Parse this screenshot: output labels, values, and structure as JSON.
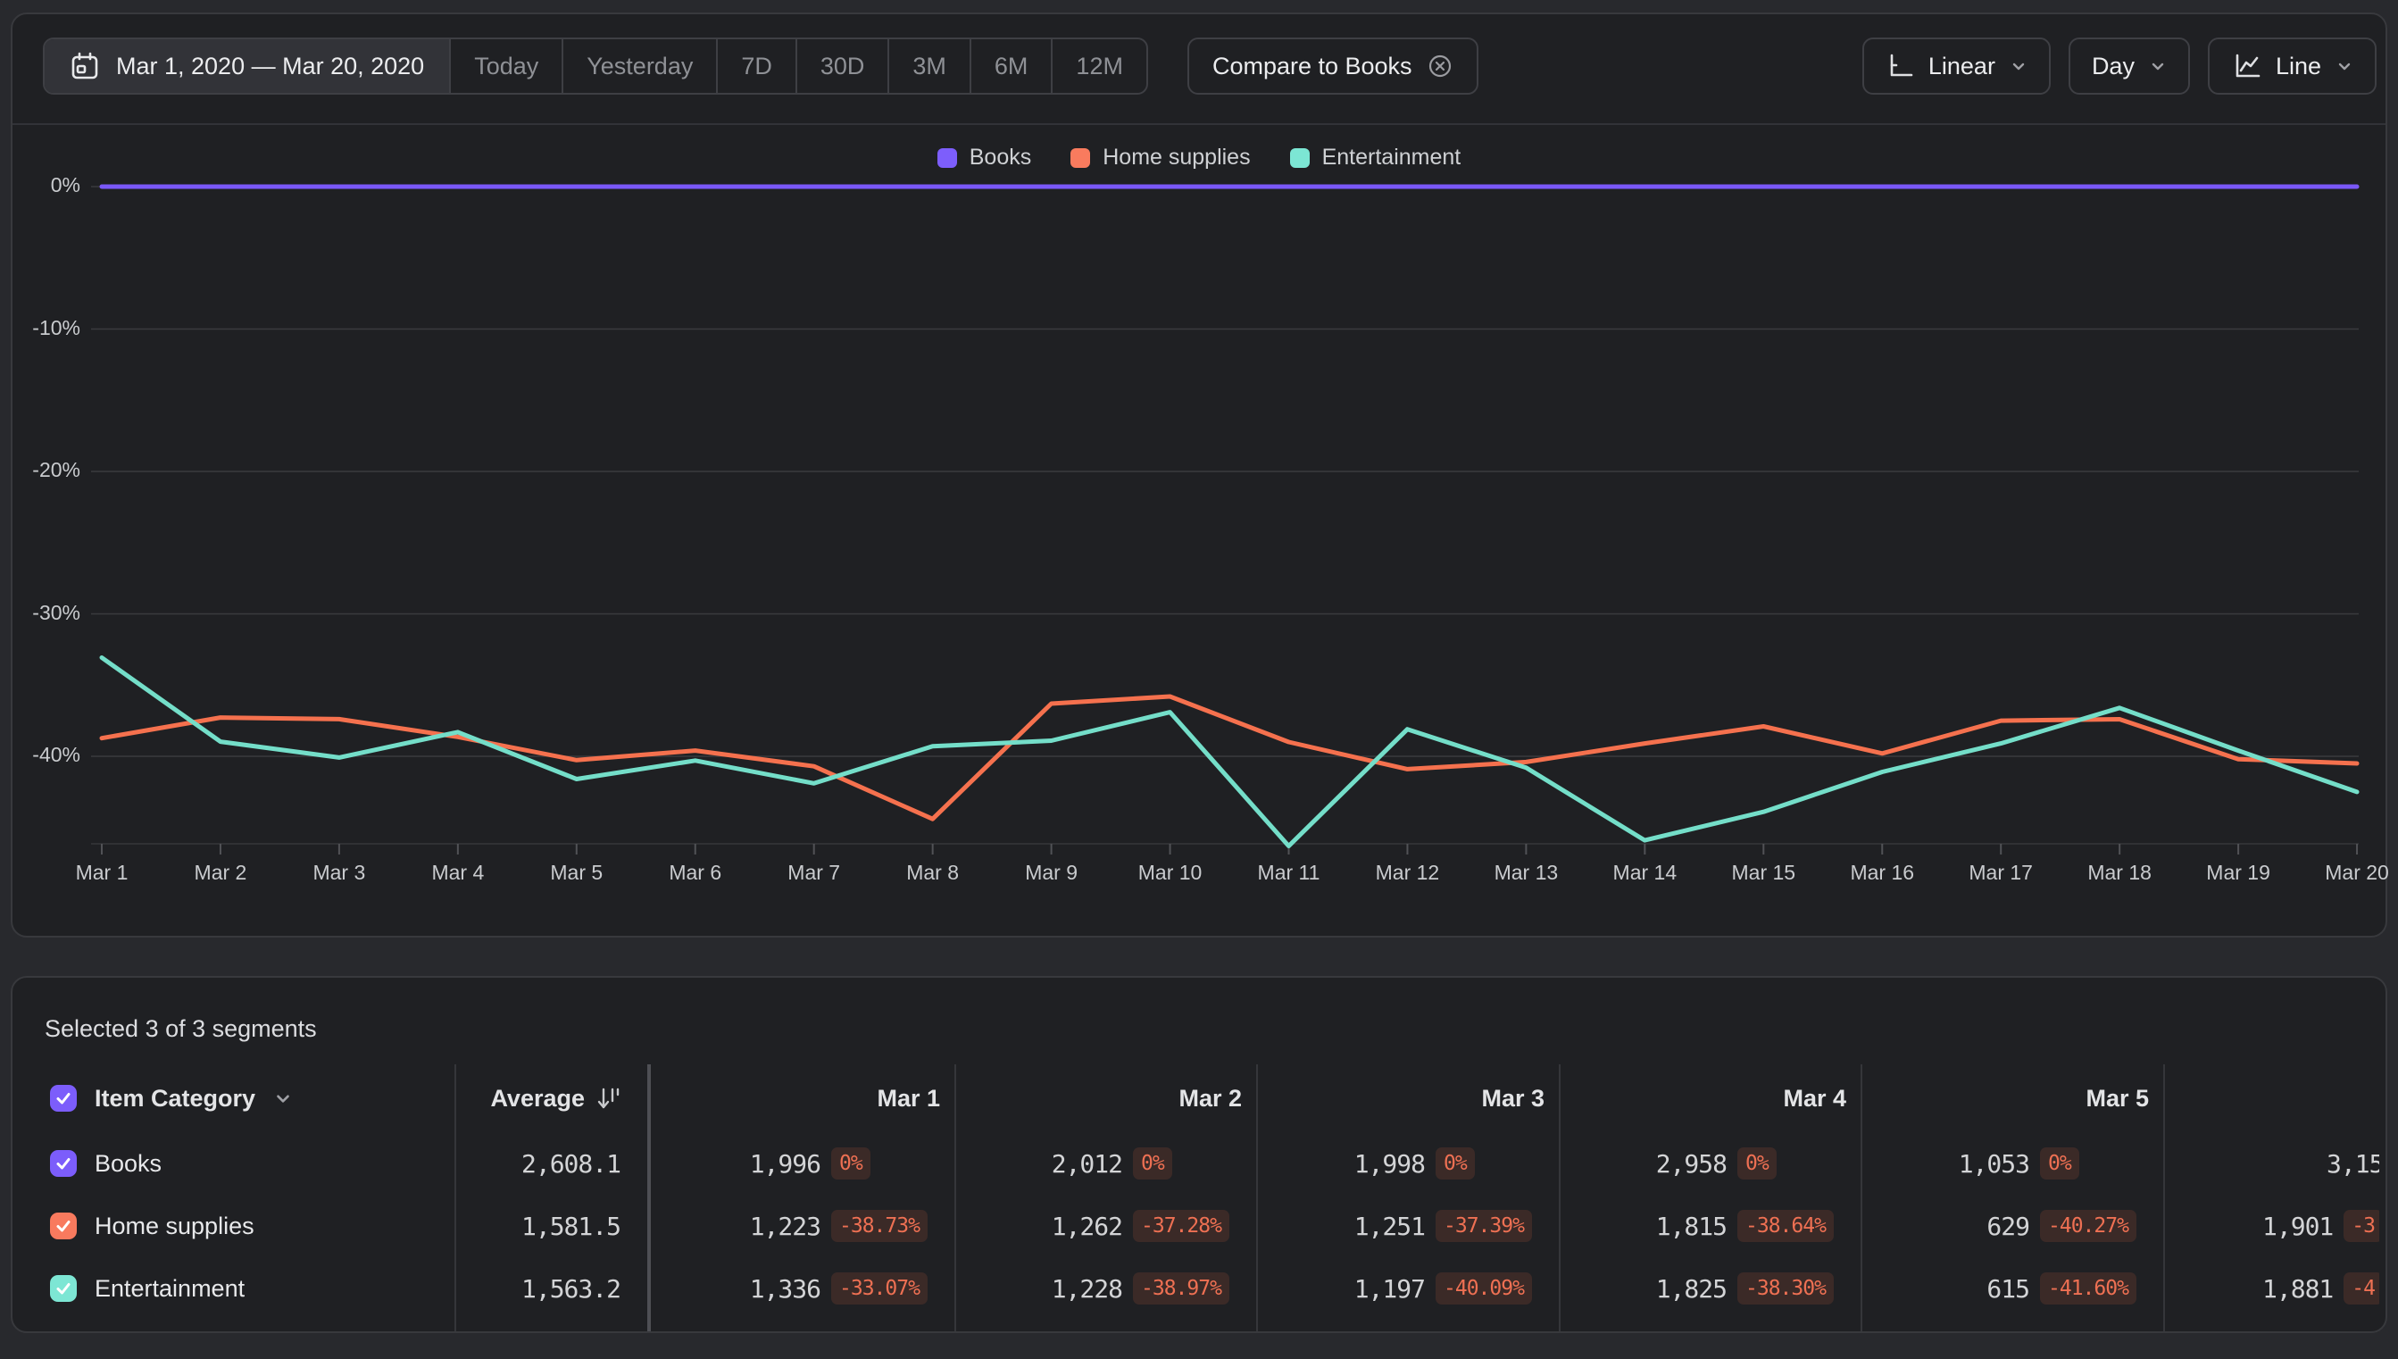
{
  "toolbar": {
    "date_range": "Mar 1, 2020 — Mar 20, 2020",
    "presets": [
      "Today",
      "Yesterday",
      "7D",
      "30D",
      "3M",
      "6M",
      "12M"
    ],
    "compare_chip": "Compare to Books",
    "scale_button": "Linear",
    "interval_button": "Day",
    "chart_type_button": "Line"
  },
  "colors": {
    "books": "#7c5dfb",
    "home_supplies": "#f87a5e",
    "entertainment": "#7de6d4",
    "badge_bg": "#3b2a27",
    "badge_text": "#ee7053",
    "gridline": "#3a3b3e"
  },
  "legend": [
    {
      "label": "Books",
      "color": "#7d5efc"
    },
    {
      "label": "Home supplies",
      "color": "#f97b5e"
    },
    {
      "label": "Entertainment",
      "color": "#7ce6d4"
    }
  ],
  "chart_data": {
    "type": "line",
    "title": "",
    "xlabel": "",
    "ylabel": "%",
    "x": [
      "Mar 1",
      "Mar 2",
      "Mar 3",
      "Mar 4",
      "Mar 5",
      "Mar 6",
      "Mar 7",
      "Mar 8",
      "Mar 9",
      "Mar 10",
      "Mar 11",
      "Mar 12",
      "Mar 13",
      "Mar 14",
      "Mar 15",
      "Mar 16",
      "Mar 17",
      "Mar 18",
      "Mar 19",
      "Mar 20"
    ],
    "y_ticks": [
      0,
      -10,
      -20,
      -30,
      -40
    ],
    "ylim": [
      -46.2,
      0
    ],
    "grid": true,
    "legend_position": "top-center",
    "series": [
      {
        "name": "Books",
        "color": "#7a58f8",
        "values": [
          0,
          0,
          0,
          0,
          0,
          0,
          0,
          0,
          0,
          0,
          0,
          0,
          0,
          0,
          0,
          0,
          0,
          0,
          0,
          0
        ]
      },
      {
        "name": "Home supplies",
        "color": "#f5714e",
        "values": [
          -38.73,
          -37.28,
          -37.39,
          -38.64,
          -40.27,
          -39.6,
          -40.7,
          -44.4,
          -36.3,
          -35.8,
          -39.0,
          -40.9,
          -40.4,
          -39.1,
          -37.9,
          -39.8,
          -37.5,
          -37.4,
          -40.2,
          -40.5
        ]
      },
      {
        "name": "Entertainment",
        "color": "#74dec9",
        "values": [
          -33.07,
          -38.97,
          -40.09,
          -38.3,
          -41.6,
          -40.3,
          -41.9,
          -39.3,
          -38.9,
          -36.9,
          -46.3,
          -38.1,
          -40.8,
          -45.9,
          -43.9,
          -41.1,
          -39.1,
          -36.6,
          -39.6,
          -42.5
        ]
      }
    ]
  },
  "table": {
    "selected_text": "Selected 3 of 3 segments",
    "category_header": "Item Category",
    "average_header": "Average",
    "day_headers": [
      "Mar 1",
      "Mar 2",
      "Mar 3",
      "Mar 4",
      "Mar 5"
    ],
    "rows": [
      {
        "label": "Books",
        "color": "#7c5dfb",
        "average": "2,608.1",
        "cells": [
          {
            "value": "1,996",
            "badge": "0%"
          },
          {
            "value": "2,012",
            "badge": "0%"
          },
          {
            "value": "1,998",
            "badge": "0%"
          },
          {
            "value": "2,958",
            "badge": "0%"
          },
          {
            "value": "1,053",
            "badge": "0%"
          }
        ],
        "clipped": {
          "value": "3,15",
          "badge": null
        }
      },
      {
        "label": "Home supplies",
        "color": "#f87a5e",
        "average": "1,581.5",
        "cells": [
          {
            "value": "1,223",
            "badge": "-38.73%"
          },
          {
            "value": "1,262",
            "badge": "-37.28%"
          },
          {
            "value": "1,251",
            "badge": "-37.39%"
          },
          {
            "value": "1,815",
            "badge": "-38.64%"
          },
          {
            "value": "629",
            "badge": "-40.27%"
          }
        ],
        "clipped": {
          "value": "1,901",
          "badge": "-3"
        }
      },
      {
        "label": "Entertainment",
        "color": "#7de6d4",
        "average": "1,563.2",
        "cells": [
          {
            "value": "1,336",
            "badge": "-33.07%"
          },
          {
            "value": "1,228",
            "badge": "-38.97%"
          },
          {
            "value": "1,197",
            "badge": "-40.09%"
          },
          {
            "value": "1,825",
            "badge": "-38.30%"
          },
          {
            "value": "615",
            "badge": "-41.60%"
          }
        ],
        "clipped": {
          "value": "1,881",
          "badge": "-4"
        }
      }
    ]
  }
}
